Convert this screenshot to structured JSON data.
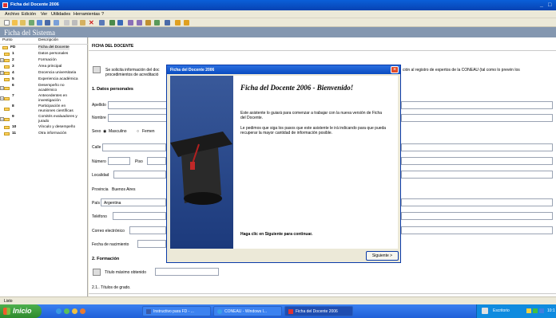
{
  "window": {
    "title": "Ficha del Docente 2006",
    "min": "_",
    "max": "□"
  },
  "menu": {
    "items": [
      "Archivo",
      "Edición",
      "Ver",
      "Utilidades",
      "Herramientas",
      "?"
    ]
  },
  "section_title": "Ficha del Sistema",
  "sidebar": {
    "col_punto": "Punto",
    "col_desc": "Descripción",
    "items": [
      {
        "num": "FD",
        "desc": "Ficha del Docente"
      },
      {
        "num": "1",
        "desc": "Datos personales"
      },
      {
        "num": "2",
        "desc": "Formación"
      },
      {
        "num": "3",
        "desc": "Área principal"
      },
      {
        "num": "4",
        "desc": "Docencia universitaria"
      },
      {
        "num": "5",
        "desc": "Experiencia académica"
      },
      {
        "num": "6",
        "desc": "Desempeño no académico"
      },
      {
        "num": "7",
        "desc": "Antecedentes en investigación"
      },
      {
        "num": "8",
        "desc": "Participación en reuniones científicas"
      },
      {
        "num": "9",
        "desc": "Comités evaluadores y jurado"
      },
      {
        "num": "10",
        "desc": "Vínculo y desempeño"
      },
      {
        "num": "11",
        "desc": "Otra información"
      }
    ]
  },
  "main": {
    "header": "FICHA DEL DOCENTE",
    "intro_a": "Se solicita información del doc",
    "intro_b": "procedimientos de acreditació",
    "intro_right": "ción al registro de expertos de la CONEAU (tal como lo prevén los",
    "section1": "1. Datos personales",
    "labels": {
      "apellido": "Apellido",
      "nombre": "Nombre",
      "sexo": "Sexo",
      "masculino": "Masculino",
      "femenino": "Femen",
      "calle": "Calle",
      "numero": "Número",
      "piso": "Piso",
      "localidad": "Localidad",
      "provincia": "Provincia",
      "pais": "País",
      "telefono": "Teléfono",
      "correo": "Correo electrónico",
      "nacimiento": "Fecha de nacimiento"
    },
    "values": {
      "provincia": "Buenos Aires",
      "pais": "Argentina"
    },
    "section2": "2. Formación",
    "titulo_maximo": "Título máximo obtenido",
    "sub21": "2.1.. Títulos de grado."
  },
  "dialog": {
    "title": "Ficha del Docente 2006",
    "heading": "Ficha del Docente 2006 - Bienvenido!",
    "p1": "Este asistente lo guiará para comenzar a trabajar con la nueva versión de Ficha del Docente.",
    "p2": "Le pedimos que siga los pasos que este asistente le irá indicando para que pueda recuperar la mayor cantidad de información posible.",
    "footer": "Haga clic en Siguiente para continuar.",
    "next_label": "Siguiente >"
  },
  "statusbar": {
    "text": "Listo"
  },
  "taskbar": {
    "start_label": "Inicio",
    "tasks": [
      "Instructivo para FD - ...",
      "CONEAU - Windows I...",
      "Ficha del Docente 2006"
    ],
    "tray_lang": "Escritorio",
    "clock": "10:1"
  },
  "colors": {
    "accent": "#0a5fd8",
    "section": "#8497b0",
    "dialog_side": "#2a4a8a"
  }
}
